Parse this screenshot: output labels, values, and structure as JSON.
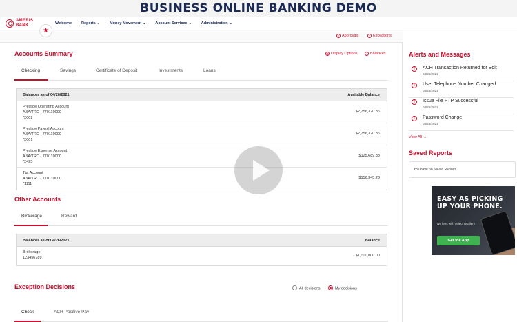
{
  "banner": {
    "title": "BUSINESS ONLINE BANKING DEMO"
  },
  "brand": {
    "line1": "AMERIS",
    "line2": "BANK",
    "accent": "#c8102e"
  },
  "nav": {
    "items": [
      {
        "label": "Welcome",
        "dropdown": false
      },
      {
        "label": "Reports",
        "dropdown": true
      },
      {
        "label": "Money Movement",
        "dropdown": true
      },
      {
        "label": "Account Services",
        "dropdown": true
      },
      {
        "label": "Administration",
        "dropdown": true
      }
    ],
    "favorite_icon": "star-icon"
  },
  "subbar": {
    "approvals": "Approvals",
    "exceptions": "Exceptions"
  },
  "accounts_summary": {
    "title": "Accounts Summary",
    "display_options": "Display Options",
    "balances": "Balances",
    "tabs": [
      "Checking",
      "Savings",
      "Certificate of Deposit",
      "Investments",
      "Loans"
    ],
    "active_tab": "Checking",
    "table": {
      "header_left": "Balances as of 04/26/2021",
      "header_right": "Available Balance",
      "rows": [
        {
          "name": "Prestige Operating Account",
          "aba": "ABA/TRC - 770110000",
          "num": "*3002",
          "amount": "$2,756,320.36"
        },
        {
          "name": "Prestige Payroll Account",
          "aba": "ABA/TRC - 770110000",
          "num": "*3001",
          "amount": "$2,756,320.36"
        },
        {
          "name": "Prestige Expense Account",
          "aba": "ABA/TRC - 770110000",
          "num": "*3425",
          "amount": "$125,689.33"
        },
        {
          "name": "Tax Account",
          "aba": "ABA/TRC - 770110000",
          "num": "*1111",
          "amount": "$156,345.23"
        }
      ]
    }
  },
  "other_accounts": {
    "title": "Other Accounts",
    "tabs": [
      "Brokerage",
      "Reward"
    ],
    "active_tab": "Brokerage",
    "table": {
      "header_left": "Balances as of 04/26/2021",
      "header_right": "Balance",
      "rows": [
        {
          "name": "Brokerage",
          "num": "123456789",
          "amount": "$1,000,000.00"
        }
      ]
    }
  },
  "exception_decisions": {
    "title": "Exception Decisions",
    "radio_all": "All decisions",
    "radio_mine": "My decisions",
    "selected": "My decisions",
    "tabs": [
      "Check",
      "ACH Positive Pay"
    ],
    "active_tab": "Check"
  },
  "alerts": {
    "title": "Alerts and Messages",
    "items": [
      {
        "text": "ACH Transaction Returned for Edit",
        "date": "04/26/2021"
      },
      {
        "text": "User Telephone Number Changed",
        "date": "04/26/2021"
      },
      {
        "text": "Issue File FTP Successful",
        "date": "04/26/2021"
      },
      {
        "text": "Password Change",
        "date": "04/26/2021"
      }
    ],
    "view_all": "View All →"
  },
  "saved_reports": {
    "title": "Saved Reports",
    "empty_text": "You have no Saved Reports."
  },
  "ad": {
    "headline1": "EASY AS PICKING",
    "headline2": "UP YOUR PHONE.",
    "sub": "No fees with select retailers",
    "button": "Get the App"
  }
}
